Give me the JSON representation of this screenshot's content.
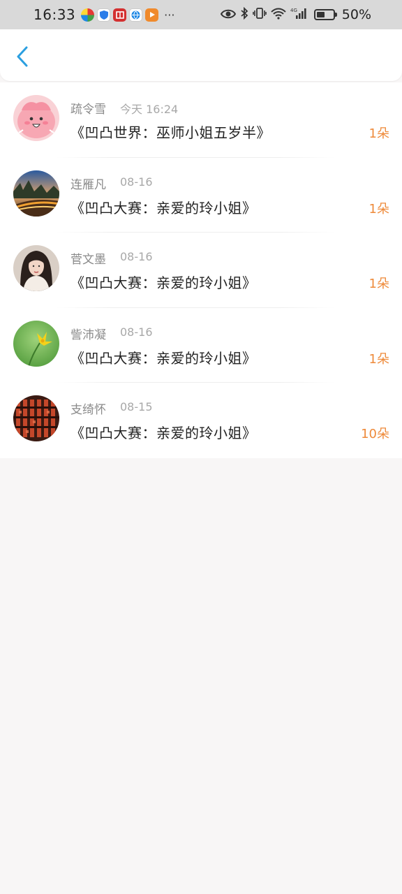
{
  "status_bar": {
    "time": "16:33",
    "more": "···",
    "network": "4G",
    "battery_percent": "50%",
    "battery_level": 0.5,
    "icons": [
      "colorwheel-app-icon",
      "shield-app-icon",
      "book-app-icon",
      "globe-app-icon",
      "play-app-icon",
      "eye-icon",
      "bluetooth-icon",
      "vibrate-icon",
      "wifi-icon",
      "signal-icon",
      "battery-icon"
    ]
  },
  "nav": {
    "back_icon": "chevron-left-icon",
    "accent": "#2b9fe0"
  },
  "list": {
    "items": [
      {
        "name": "疏令雪",
        "time": "今天 16:24",
        "title": "《凹凸世界：巫师小姐五岁半》",
        "count": "1朵",
        "avatar": "cartoon-avatar"
      },
      {
        "name": "连雁凡",
        "time": "08-16",
        "title": "《凹凸大赛：亲爱的玲小姐》",
        "count": "1朵",
        "avatar": "road-sunset-avatar"
      },
      {
        "name": "菅文墨",
        "time": "08-16",
        "title": "《凹凸大赛：亲爱的玲小姐》",
        "count": "1朵",
        "avatar": "girl-photo-avatar"
      },
      {
        "name": "訾沛凝",
        "time": "08-16",
        "title": "《凹凸大赛：亲爱的玲小姐》",
        "count": "1朵",
        "avatar": "yellow-flower-avatar"
      },
      {
        "name": "支绮怀",
        "time": "08-15",
        "title": "《凹凸大赛：亲爱的玲小姐》",
        "count": "10朵",
        "avatar": "red-pattern-avatar"
      }
    ]
  },
  "colors": {
    "count_orange": "#ee8a3a",
    "name_gray": "#8a8a8a",
    "background": "#f8f6f6"
  }
}
